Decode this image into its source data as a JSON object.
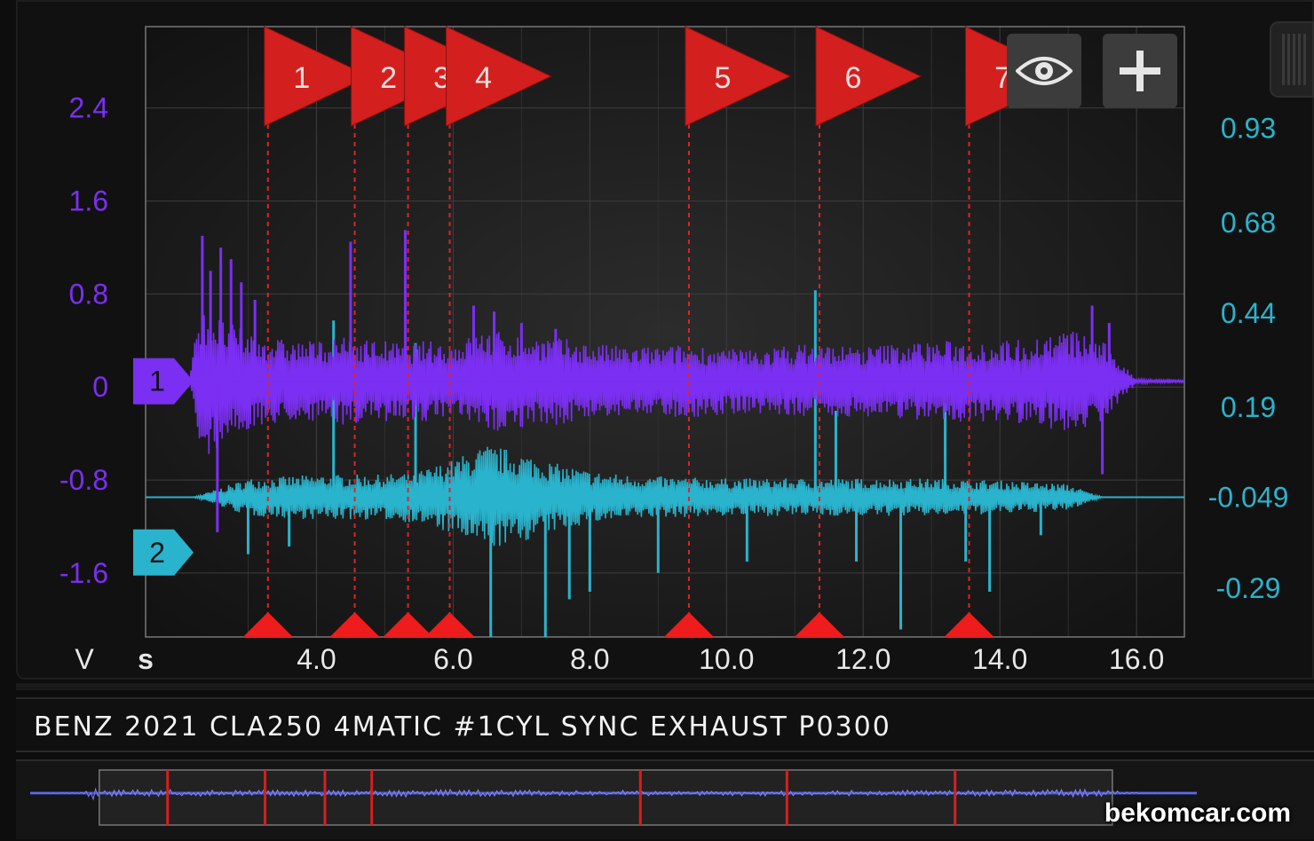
{
  "chart_data": {
    "type": "line",
    "x_unit": "s",
    "x_ticks": [
      4.0,
      6.0,
      8.0,
      10.0,
      12.0,
      14.0,
      16.0
    ],
    "xlim": [
      1.5,
      16.7
    ],
    "left_axis": {
      "unit": "V",
      "ticks": [
        "2.4",
        "1.6",
        "0.8",
        "0",
        "-0.8",
        "-1.6"
      ],
      "tick_values": [
        2.4,
        1.6,
        0.8,
        0,
        -0.8,
        -1.6
      ],
      "ylim": [
        -2.15,
        3.1
      ],
      "color": "#7b2ff2"
    },
    "right_axis": {
      "ticks": [
        "0.93",
        "0.68",
        "0.44",
        "0.19",
        "-0.049",
        "-0.29"
      ],
      "tick_values": [
        0.93,
        0.68,
        0.44,
        0.19,
        -0.049,
        -0.29
      ],
      "ylim": [
        -0.42,
        1.2
      ],
      "color": "#2ab3cc"
    },
    "grid": true,
    "series": [
      {
        "channel_label": "1",
        "axis": "left",
        "color": "#7b2ff2",
        "offset": 0.05,
        "x": [
          1.5,
          2.15,
          2.3,
          2.6,
          2.9,
          3.2,
          3.6,
          4.0,
          4.5,
          5.0,
          5.3,
          5.6,
          6.0,
          6.5,
          7.0,
          7.5,
          8.0,
          8.5,
          9.0,
          9.5,
          10.0,
          10.5,
          11.0,
          11.5,
          12.0,
          12.5,
          13.0,
          13.5,
          14.0,
          14.5,
          15.0,
          15.4,
          15.6,
          15.8,
          16.0,
          16.7
        ],
        "envelope": [
          0,
          0.05,
          0.7,
          0.55,
          0.45,
          0.4,
          0.35,
          0.35,
          0.38,
          0.35,
          0.32,
          0.35,
          0.33,
          0.45,
          0.4,
          0.38,
          0.33,
          0.3,
          0.3,
          0.32,
          0.28,
          0.28,
          0.32,
          0.32,
          0.3,
          0.33,
          0.35,
          0.35,
          0.35,
          0.38,
          0.45,
          0.38,
          0.3,
          0.15,
          0.02,
          0.01
        ],
        "spikes": [
          {
            "x": 2.33,
            "y": 1.3
          },
          {
            "x": 2.45,
            "y": 1.0
          },
          {
            "x": 2.6,
            "y": 1.2
          },
          {
            "x": 2.75,
            "y": 1.1
          },
          {
            "x": 2.9,
            "y": 0.9
          },
          {
            "x": 3.1,
            "y": 0.75
          },
          {
            "x": 4.5,
            "y": 1.25
          },
          {
            "x": 5.3,
            "y": 1.35
          },
          {
            "x": 6.3,
            "y": 0.7
          },
          {
            "x": 6.6,
            "y": 0.65
          },
          {
            "x": 7.0,
            "y": 0.55
          },
          {
            "x": 7.5,
            "y": 0.5
          },
          {
            "x": 15.35,
            "y": 0.7
          },
          {
            "x": 15.6,
            "y": 0.55
          },
          {
            "x": 2.55,
            "y": -1.25
          },
          {
            "x": 15.5,
            "y": -0.75
          }
        ]
      },
      {
        "channel_label": "2",
        "axis": "right",
        "color": "#2ab3cc",
        "baseline": -0.049,
        "x": [
          1.5,
          2.2,
          3.0,
          4.0,
          5.0,
          5.5,
          6.0,
          6.5,
          7.0,
          7.5,
          8.0,
          8.5,
          9.0,
          10.0,
          11.0,
          12.0,
          13.0,
          14.0,
          14.5,
          15.0,
          15.5,
          16.7
        ],
        "envelope": [
          0,
          0,
          0.05,
          0.06,
          0.06,
          0.07,
          0.1,
          0.14,
          0.12,
          0.09,
          0.07,
          0.06,
          0.055,
          0.05,
          0.05,
          0.05,
          0.05,
          0.045,
          0.04,
          0.035,
          0,
          0
        ],
        "spikes": [
          {
            "x": 4.25,
            "y": 0.42
          },
          {
            "x": 5.45,
            "y": 0.36
          },
          {
            "x": 11.3,
            "y": 0.5
          },
          {
            "x": 11.6,
            "y": 0.18
          },
          {
            "x": 13.2,
            "y": 0.2
          },
          {
            "x": 6.55,
            "y": -0.42
          },
          {
            "x": 7.35,
            "y": -0.42
          },
          {
            "x": 7.7,
            "y": -0.32
          },
          {
            "x": 8.0,
            "y": -0.3
          },
          {
            "x": 12.55,
            "y": -0.4
          },
          {
            "x": 13.85,
            "y": -0.3
          },
          {
            "x": 3.0,
            "y": -0.2
          },
          {
            "x": 3.6,
            "y": -0.18
          },
          {
            "x": 9.0,
            "y": -0.25
          },
          {
            "x": 10.3,
            "y": -0.22
          },
          {
            "x": 11.9,
            "y": -0.22
          },
          {
            "x": 13.5,
            "y": -0.22
          },
          {
            "x": 14.6,
            "y": -0.15
          }
        ]
      }
    ],
    "markers": [
      {
        "label": "1",
        "x": 3.29
      },
      {
        "label": "2",
        "x": 4.56
      },
      {
        "label": "3",
        "x": 5.34
      },
      {
        "label": "4",
        "x": 5.95
      },
      {
        "label": "5",
        "x": 9.45
      },
      {
        "label": "6",
        "x": 11.36
      },
      {
        "label": "7",
        "x": 13.55
      }
    ]
  },
  "capture_title": "BENZ 2021 CLA250 4MATIC #1CYL SYNC EXHAUST P0300",
  "watermark": "bekomcar.com",
  "tools": {
    "eye_icon": "eye-icon",
    "plus_icon": "plus-icon"
  }
}
